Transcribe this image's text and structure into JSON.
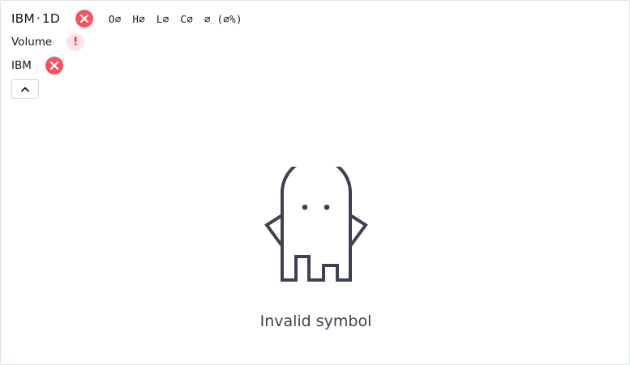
{
  "legend": {
    "symbol": "IBM",
    "separator": "·",
    "interval": "1D",
    "ohlc": {
      "o": "O∅",
      "h": "H∅",
      "l": "L∅",
      "c": "C∅",
      "change": "∅ (∅%)"
    },
    "volume_label": "Volume",
    "warning_glyph": "!",
    "compare_label": "IBM"
  },
  "empty_state": {
    "message": "Invalid symbol",
    "icon": "ghost-icon"
  },
  "icons": {
    "error": "close-icon",
    "warning": "exclamation-icon",
    "collapse": "chevron-up-icon"
  },
  "colors": {
    "error_badge": "#f7525f",
    "warning_badge_bg": "#fde3e5",
    "warning_glyph": "#f23645",
    "text": "#131722",
    "ghost_stroke": "#3d4250"
  }
}
